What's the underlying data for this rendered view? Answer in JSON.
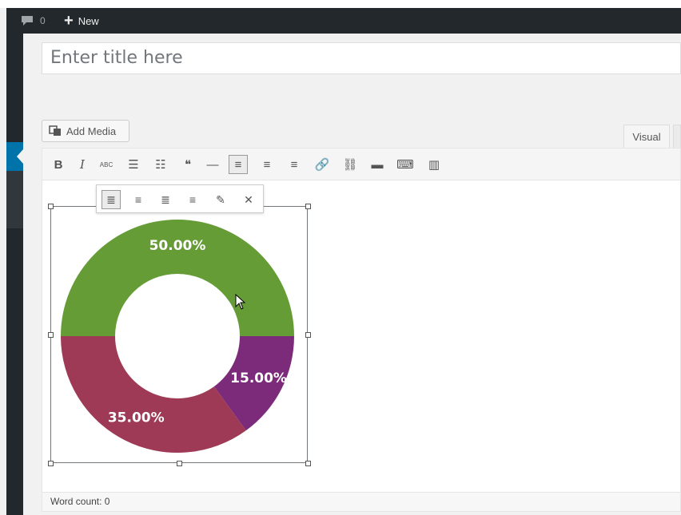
{
  "adminbar": {
    "comments_count": "0",
    "new_label": "New"
  },
  "editor": {
    "title_placeholder": "Enter title here",
    "add_media_label": "Add Media",
    "tab_visual": "Visual",
    "word_count": "Word count: 0"
  },
  "toolbar": [
    {
      "name": "bold-button",
      "icon": "bold-icon",
      "glyph": "B"
    },
    {
      "name": "italic-button",
      "icon": "italic-icon",
      "glyph": "I"
    },
    {
      "name": "strikethrough-button",
      "icon": "strikethrough-icon",
      "glyph": "ABC"
    },
    {
      "name": "bullet-list-button",
      "icon": "bullet-list-icon",
      "glyph": "☰"
    },
    {
      "name": "numbered-list-button",
      "icon": "numbered-list-icon",
      "glyph": "☷"
    },
    {
      "name": "blockquote-button",
      "icon": "quote-icon",
      "glyph": "❝"
    },
    {
      "name": "horizontal-line-button",
      "icon": "horizontal-line-icon",
      "glyph": "—"
    },
    {
      "name": "align-left-button",
      "icon": "align-left-icon",
      "glyph": "≡"
    },
    {
      "name": "align-center-button",
      "icon": "align-center-icon",
      "glyph": "≡"
    },
    {
      "name": "align-right-button",
      "icon": "align-right-icon",
      "glyph": "≡"
    },
    {
      "name": "insert-link-button",
      "icon": "link-icon",
      "glyph": "🔗"
    },
    {
      "name": "remove-link-button",
      "icon": "unlink-icon",
      "glyph": "⛓"
    },
    {
      "name": "read-more-button",
      "icon": "read-more-icon",
      "glyph": "▬"
    },
    {
      "name": "toolbar-toggle-button",
      "icon": "keyboard-icon",
      "glyph": "⌨"
    },
    {
      "name": "chart-plugin-button",
      "icon": "chart-plugin-icon",
      "glyph": "▥"
    }
  ],
  "image_toolbar": [
    {
      "name": "image-align-left-button",
      "icon": "align-left-icon",
      "glyph": "≣"
    },
    {
      "name": "image-align-center-button",
      "icon": "align-center-icon",
      "glyph": "≡"
    },
    {
      "name": "image-align-right-button",
      "icon": "align-right-icon",
      "glyph": "≣"
    },
    {
      "name": "image-align-none-button",
      "icon": "align-none-icon",
      "glyph": "≡"
    },
    {
      "name": "image-edit-button",
      "icon": "pencil-icon",
      "glyph": "✎"
    },
    {
      "name": "image-remove-button",
      "icon": "close-icon",
      "glyph": "✕"
    }
  ],
  "chart_data": {
    "type": "pie",
    "subtype": "donut",
    "slices": [
      {
        "label": "50.00%",
        "value": 50,
        "color": "#659c36"
      },
      {
        "label": "15.00%",
        "value": 15,
        "color": "#7c2a7a"
      },
      {
        "label": "35.00%",
        "value": 35,
        "color": "#9e3a55"
      }
    ],
    "title": "",
    "legend": "none"
  }
}
